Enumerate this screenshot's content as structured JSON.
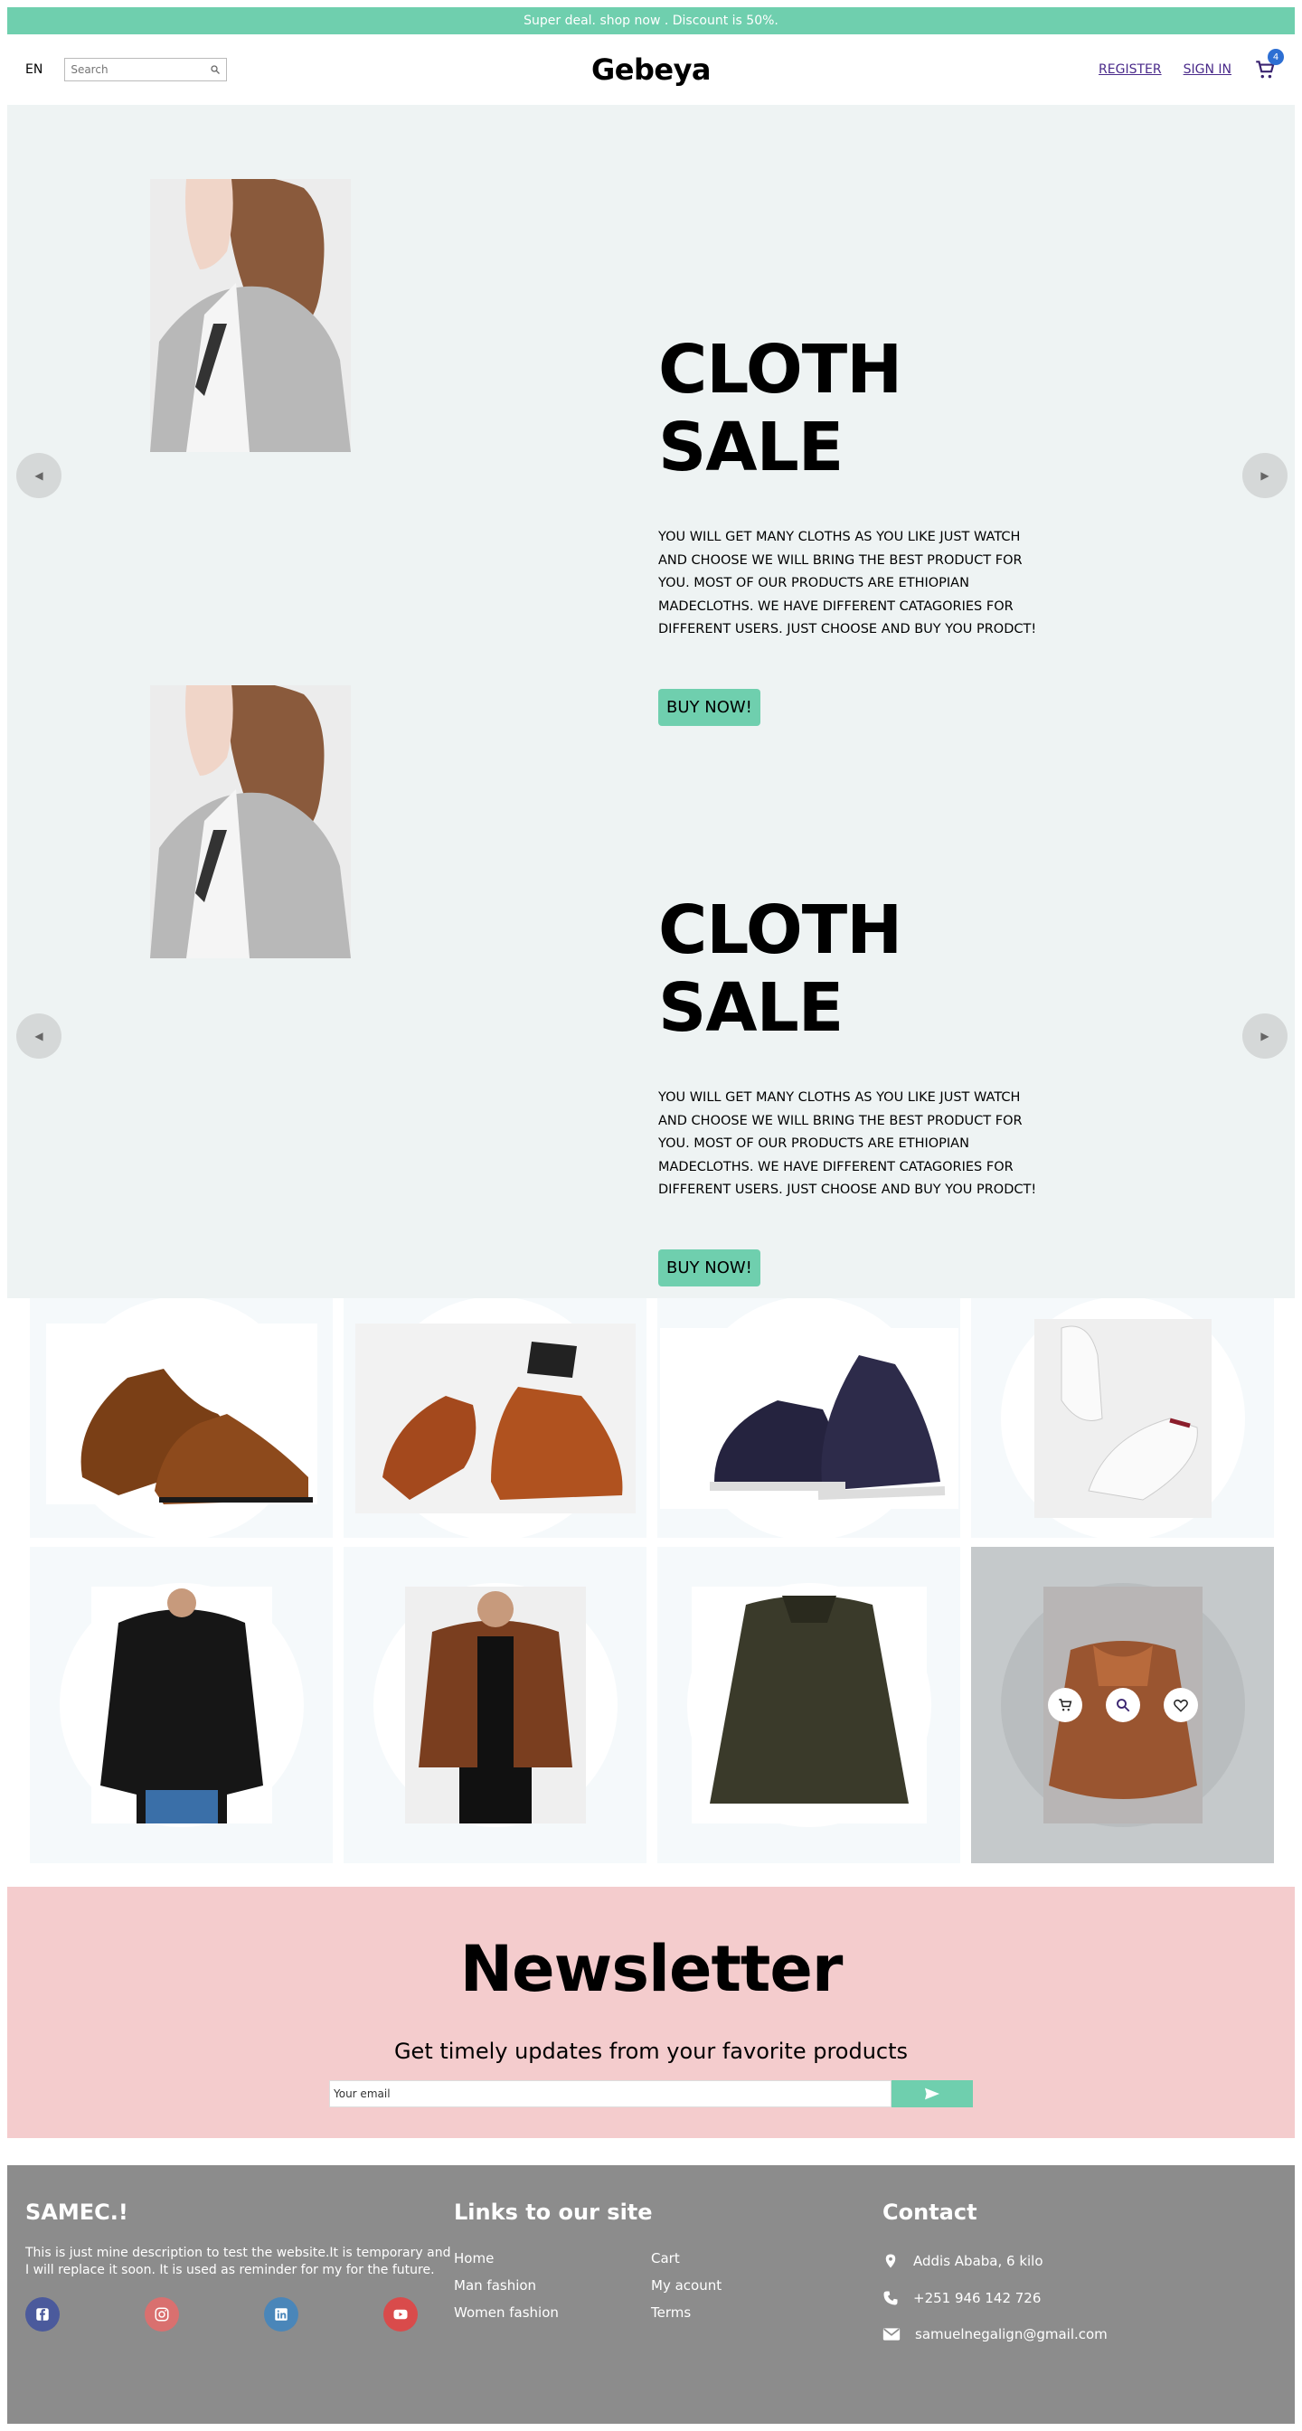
{
  "announcement": "Super deal. shop now . Discount is 50%.",
  "nav": {
    "lang": "EN",
    "search_placeholder": "Search",
    "logo": "Gebeya",
    "register": "REGISTER",
    "signin": "SIGN IN",
    "cart_count": "4"
  },
  "slides": [
    {
      "title": "CLOTH SALE",
      "description": "YOU WILL GET MANY CLOTHS AS YOU LIKE JUST WATCH AND CHOOSE WE WILL BRING THE BEST PRODUCT FOR YOU. MOST OF OUR PRODUCTS ARE ETHIOPIAN MADECLOTHS. WE HAVE DIFFERENT CATAGORIES FOR DIFFERENT USERS. JUST CHOOSE AND BUY YOU PRODCT!",
      "button": "BUY NOW!"
    },
    {
      "title": "CLOTH SALE",
      "description": "YOU WILL GET MANY CLOTHS AS YOU LIKE JUST WATCH AND CHOOSE WE WILL BRING THE BEST PRODUCT FOR YOU. MOST OF OUR PRODUCTS ARE ETHIOPIAN MADECLOTHS. WE HAVE DIFFERENT CATAGORIES FOR DIFFERENT USERS. JUST CHOOSE AND BUY YOU PRODCT!",
      "button": "BUY NOW!"
    }
  ],
  "products": [
    "brown-oxford-shoes",
    "brown-loafer-shoes",
    "navy-sneakers",
    "white-sneakers",
    "black-leather-jacket",
    "brown-leather-jacket",
    "olive-field-jacket",
    "brown-fur-jacket"
  ],
  "newsletter": {
    "title": "Newsletter",
    "subtitle": "Get timely updates from your favorite products",
    "email_placeholder": "Your email"
  },
  "footer": {
    "brand": "SAMEC.!",
    "description": "This is just mine description to test the website.It is temporary and I will replace it soon. It is used as reminder for my for the future.",
    "links_title": "Links to our site",
    "links": [
      "Home",
      "Cart",
      "Man fashion",
      "My acount",
      "Women fashion",
      "Terms"
    ],
    "contact_title": "Contact",
    "address": "Addis Ababa, 6 kilo",
    "phone": "+251 946 142 726",
    "email": "samuelnegalign@gmail.com"
  },
  "colors": {
    "accent": "#6fcfae",
    "newsletter_bg": "#f4cccd",
    "footer_bg": "#8c8c8c",
    "hero_bg": "#eef3f3"
  }
}
